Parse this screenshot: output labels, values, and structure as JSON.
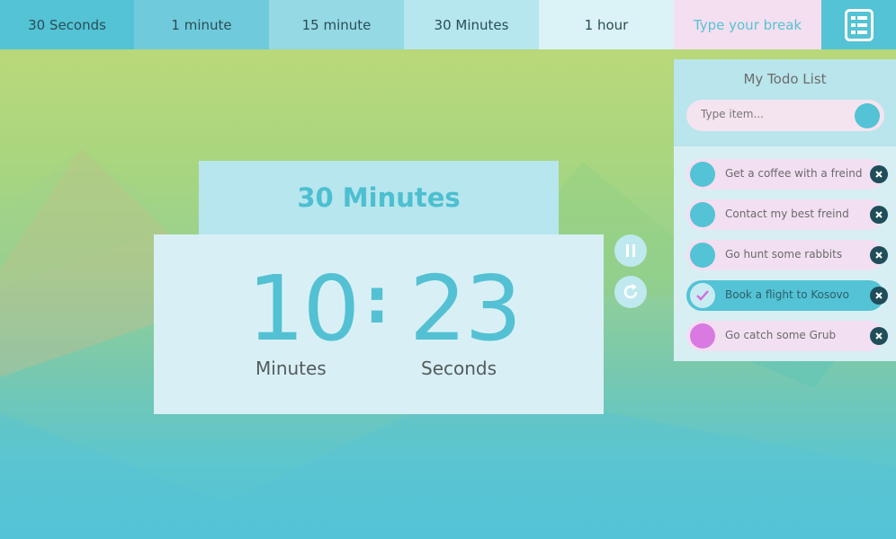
{
  "tabs": [
    {
      "label": "30 Seconds",
      "bg": "#53c3d5"
    },
    {
      "label": "1 minute",
      "bg": "#6fcbdc"
    },
    {
      "label": "15 minute",
      "bg": "#94d9e4"
    },
    {
      "label": "30 Minutes",
      "bg": "#b6e6ee"
    },
    {
      "label": "1 hour",
      "bg": "#dbf2f6"
    }
  ],
  "break_input": {
    "placeholder": "Type your break"
  },
  "menu_icon": "todo-list-icon",
  "timer": {
    "title": "30 Minutes",
    "minutes": "10",
    "seconds": "23",
    "separator": ":",
    "minutes_label": "Minutes",
    "seconds_label": "Seconds",
    "pause_icon": "pause-icon",
    "reset_icon": "refresh-icon"
  },
  "todo": {
    "title": "My Todo List",
    "input_placeholder": "Type item...",
    "items": [
      {
        "text": "Get a coffee with a freind",
        "done": false,
        "check_color": "#53c3d5"
      },
      {
        "text": "Contact my best freind",
        "done": false,
        "check_color": "#53c3d5"
      },
      {
        "text": "Go hunt some rabbits",
        "done": false,
        "check_color": "#53c3d5"
      },
      {
        "text": "Book a flight to Kosovo",
        "done": true,
        "check_color": "#c9ecf3"
      },
      {
        "text": "Go catch some Grub",
        "done": false,
        "check_color": "#d97ae3"
      }
    ]
  },
  "colors": {
    "accent": "#53c3d5",
    "pink": "#f2dff1",
    "dark": "#1f4e5a"
  }
}
